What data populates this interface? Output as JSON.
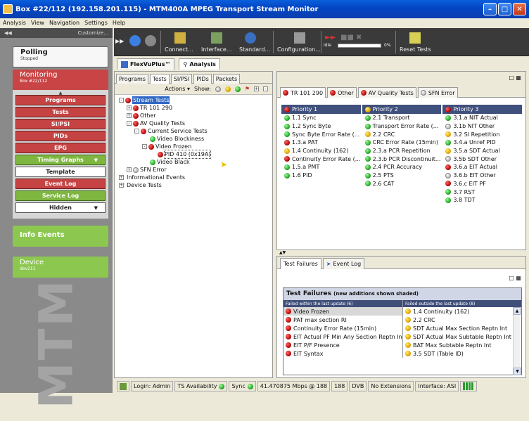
{
  "window": {
    "title": "Box #22/112 (192.158.201.115) - MTM400A MPEG Transport Stream Monitor"
  },
  "menu": [
    "Analysis",
    "View",
    "Navigation",
    "Settings",
    "Help"
  ],
  "left": {
    "customize": "Customize...",
    "polling": {
      "title": "Polling",
      "sub": "Stopped"
    },
    "monitoring": {
      "title": "Monitoring",
      "sub": "Box #22/112"
    },
    "nav": [
      {
        "label": "Programs",
        "style": "red"
      },
      {
        "label": "Tests",
        "style": "red"
      },
      {
        "label": "SI/PSI",
        "style": "red"
      },
      {
        "label": "PIDs",
        "style": "red"
      },
      {
        "label": "EPG",
        "style": "red"
      },
      {
        "label": "Timing Graphs",
        "style": "green",
        "dropdown": true
      },
      {
        "label": "Template",
        "style": "white"
      },
      {
        "label": "Event Log",
        "style": "red"
      },
      {
        "label": "Service Log",
        "style": "green"
      },
      {
        "label": "Hidden",
        "style": "white",
        "dropdown": true
      }
    ],
    "info_events": "Info Events",
    "device": {
      "title": "Device",
      "sub": "dev211"
    },
    "watermark": "MTM"
  },
  "toolbar": {
    "connect": "Connect...",
    "interface": "Interface...",
    "standard": "Standard...",
    "configuration": "Configuration...",
    "idle": "Idle",
    "progress_percent": 0,
    "progress_text": "0%",
    "reset": "Reset Tests"
  },
  "view_tabs": [
    "FlexVuPlus™",
    "Analysis"
  ],
  "left_tabs": [
    "Programs",
    "Tests",
    "SI/PSI",
    "PIDs",
    "Packets"
  ],
  "actions": {
    "actions": "Actions",
    "show": "Show:"
  },
  "tree": [
    {
      "label": "Stream Tests",
      "level": 0,
      "exp": "-",
      "dot": "r",
      "selected": true
    },
    {
      "label": "TR 101 290",
      "level": 1,
      "exp": "+",
      "dot": "r"
    },
    {
      "label": "Other",
      "level": 1,
      "exp": "+",
      "dot": "r"
    },
    {
      "label": "AV Quality Tests",
      "level": 1,
      "exp": "-",
      "dot": "r"
    },
    {
      "label": "Current Service Tests",
      "level": 2,
      "exp": "-",
      "dot": "r"
    },
    {
      "label": "Video Blockiness",
      "level": 3,
      "exp": "",
      "dot": "g"
    },
    {
      "label": "Video Frozen",
      "level": 3,
      "exp": "-",
      "dot": "r"
    },
    {
      "label": "PID 410 (0x19A)",
      "level": 4,
      "exp": "",
      "dot": "r",
      "boxed": true
    },
    {
      "label": "Video Black",
      "level": 3,
      "exp": "",
      "dot": "g"
    },
    {
      "label": "SFN Error",
      "level": 1,
      "exp": "+",
      "dot": "w"
    },
    {
      "label": "Informational Events",
      "level": 0,
      "exp": "+",
      "dot": ""
    },
    {
      "label": "Device Tests",
      "level": 0,
      "exp": "+",
      "dot": ""
    }
  ],
  "right_tabs": [
    {
      "label": "TR 101 290",
      "dot": "r"
    },
    {
      "label": "Other",
      "dot": "r"
    },
    {
      "label": "AV Quality Tests",
      "dot": "r"
    },
    {
      "label": "SFN Error",
      "dot": "w"
    }
  ],
  "priorities": [
    {
      "header": "Priority 1",
      "dot": "r",
      "items": [
        {
          "label": "1.1 Sync",
          "dot": "g"
        },
        {
          "label": "1.2 Sync Byte",
          "dot": "g"
        },
        {
          "label": "Sync Byte Error Rate (...",
          "dot": "g"
        },
        {
          "label": "1.3.a PAT",
          "dot": "r"
        },
        {
          "label": "1.4 Continuity (162)",
          "dot": "y"
        },
        {
          "label": "Continuity Error Rate (...",
          "dot": "r"
        },
        {
          "label": "1.5.a PMT",
          "dot": "g"
        },
        {
          "label": "1.6 PID",
          "dot": "g"
        }
      ]
    },
    {
      "header": "Priority 2",
      "dot": "y",
      "items": [
        {
          "label": "2.1 Transport",
          "dot": "g"
        },
        {
          "label": "Transport Error Rate (...",
          "dot": "g"
        },
        {
          "label": "2.2 CRC",
          "dot": "y"
        },
        {
          "label": "CRC Error Rate (15min)",
          "dot": "g"
        },
        {
          "label": "2.3.a PCR Repetition",
          "dot": "g"
        },
        {
          "label": "2.3.b PCR Discontinuit...",
          "dot": "g"
        },
        {
          "label": "2.4 PCR Accuracy",
          "dot": "g"
        },
        {
          "label": "2.5 PTS",
          "dot": "g"
        },
        {
          "label": "2.6 CAT",
          "dot": "g"
        }
      ]
    },
    {
      "header": "Priority 3",
      "dot": "r",
      "items": [
        {
          "label": "3.1.a NIT Actual",
          "dot": "g"
        },
        {
          "label": "3.1b NIT Other",
          "dot": "w"
        },
        {
          "label": "3.2 SI Repetition",
          "dot": "y"
        },
        {
          "label": "3.4.a Unref PID",
          "dot": "g"
        },
        {
          "label": "3.5.a SDT Actual",
          "dot": "y"
        },
        {
          "label": "3.5b SDT Other",
          "dot": "w"
        },
        {
          "label": "3.6.a EIT Actual",
          "dot": "r"
        },
        {
          "label": "3.6.b EIT Other",
          "dot": "w"
        },
        {
          "label": "3.6.c EIT PF",
          "dot": "r"
        },
        {
          "label": "3.7 RST",
          "dot": "g"
        },
        {
          "label": "3.8 TDT",
          "dot": "g"
        }
      ]
    }
  ],
  "bottom_tabs": [
    "Test Failures",
    "Event Log"
  ],
  "failures": {
    "title": "Test Failures",
    "subtitle": "(new additions shown shaded)",
    "within_header": "Failed within the last update (6)",
    "outside_header": "Failed outside the last update (8)",
    "within": [
      {
        "label": "Video Frozen",
        "dot": "r",
        "shaded": true
      },
      {
        "label": "PAT max section RI",
        "dot": "r"
      },
      {
        "label": "Continuity Error Rate (15min)",
        "dot": "r"
      },
      {
        "label": "EIT Actual PF Min Any Section Reptn Int",
        "dot": "r"
      },
      {
        "label": "EIT P/F Presence",
        "dot": "r"
      },
      {
        "label": "EIT Syntax",
        "dot": "r"
      }
    ],
    "outside": [
      {
        "label": "1.4 Continuity (162)",
        "dot": "y"
      },
      {
        "label": "2.2 CRC",
        "dot": "y"
      },
      {
        "label": "SDT Actual Max Section Reptn Int",
        "dot": "y"
      },
      {
        "label": "SDT Actual Max Subtable Reptn Int",
        "dot": "y"
      },
      {
        "label": "BAT Max Subtable Reptn Int",
        "dot": "y"
      },
      {
        "label": "3.5 SDT (Table ID)",
        "dot": "y"
      }
    ]
  },
  "status": {
    "login": "Login: Admin",
    "ts": "TS Availability",
    "sync": "Sync",
    "rate": "41.470875 Mbps @ 188",
    "packet": "188",
    "dvb": "DVB",
    "ext": "No Extensions",
    "iface": "Interface: ASI"
  }
}
